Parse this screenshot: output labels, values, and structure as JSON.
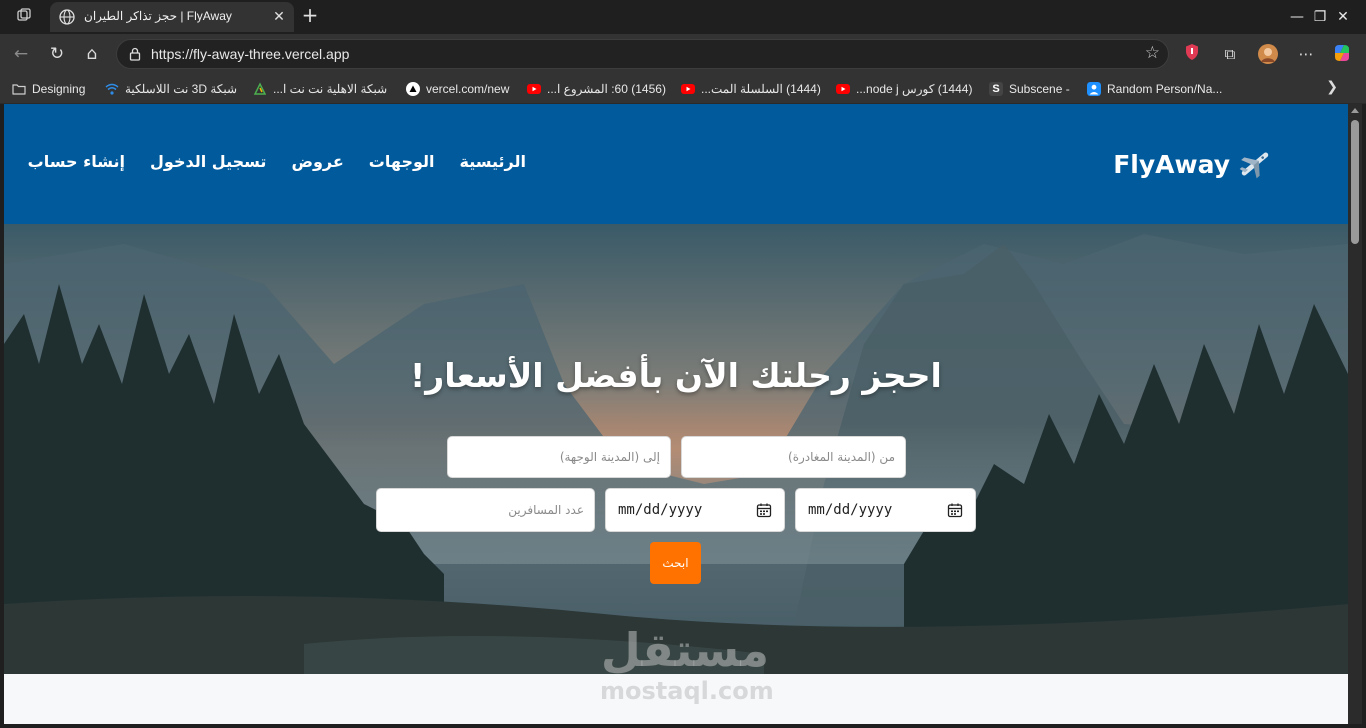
{
  "browser": {
    "tab_title": "حجز تذاكر الطيران | FlyAway",
    "url": "https://fly-away-three.vercel.app",
    "bookmarks": [
      {
        "label": "Designing",
        "icon": "folder-icon",
        "color": "#cfcfcf"
      },
      {
        "label": "شبكة 3D نت اللاسلكية",
        "icon": "wifi-icon",
        "color": "#2f8ce6"
      },
      {
        "label": "شبكة الاهلية نت نت ا...",
        "icon": "network-logo-icon",
        "color": "#4caf50"
      },
      {
        "label": "vercel.com/new",
        "icon": "vercel-icon",
        "color": "#ffffff"
      },
      {
        "label": "(1456) 60: المشروع ا...",
        "icon": "youtube-icon",
        "color": "#ff0000"
      },
      {
        "label": "(1444) السلسلة المت...",
        "icon": "youtube-icon",
        "color": "#ff0000"
      },
      {
        "label": "(1444) كورس node j...",
        "icon": "youtube-icon",
        "color": "#ff0000"
      },
      {
        "label": "Subscene -",
        "icon": "subscene-icon",
        "color": "#444444"
      },
      {
        "label": "Random Person/Na...",
        "icon": "person-icon",
        "color": "#1e90ff"
      }
    ]
  },
  "site": {
    "brand": "FlyAway",
    "brand_icon": "airplane-icon",
    "header_color": "#005a9c",
    "nav": [
      {
        "label": "الرئيسية"
      },
      {
        "label": "الوجهات"
      },
      {
        "label": "عروض"
      },
      {
        "label": "تسجيل الدخول"
      },
      {
        "label": "إنشاء حساب"
      }
    ]
  },
  "hero": {
    "title": "احجز رحلتك الآن بأفضل الأسعار!",
    "from_placeholder": "من (المدينة المغادرة)",
    "to_placeholder": "إلى (المدينة الوجهة)",
    "depart_date": "mm/dd/yyyy",
    "return_date": "mm/dd/yyyy",
    "passengers_placeholder": "عدد المسافرين",
    "search_label": "ابحث",
    "accent": "#ff7200"
  },
  "watermark": {
    "ar": "مستقل",
    "en": "mostaql.com"
  }
}
